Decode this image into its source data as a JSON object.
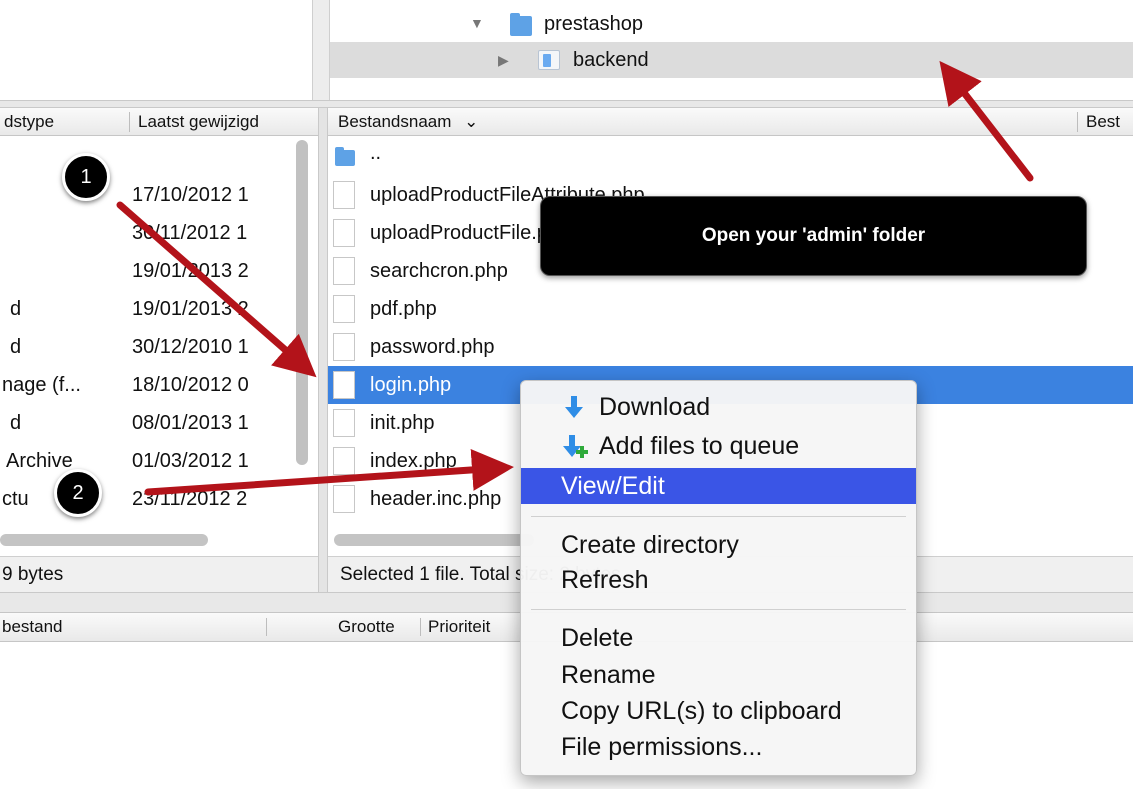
{
  "remote_tree": {
    "items": [
      {
        "label": "prestashop",
        "expanded": true
      },
      {
        "label": "backend",
        "expanded": false,
        "selected": true
      }
    ]
  },
  "left_pane": {
    "columns": [
      "dstype",
      "Laatst gewijzigd"
    ],
    "rows": [
      {
        "type": "",
        "modified": "17/10/2012 1"
      },
      {
        "type": "",
        "modified": "30/11/2012 1"
      },
      {
        "type": "",
        "modified": "19/01/2013 2"
      },
      {
        "type": "d",
        "modified": "19/01/2013 2"
      },
      {
        "type": "d",
        "modified": "30/12/2010 1"
      },
      {
        "type": "nage (f...",
        "modified": "18/10/2012 0"
      },
      {
        "type": "d",
        "modified": "08/01/2013 1"
      },
      {
        "type": "Archive",
        "modified": "01/03/2012 1"
      },
      {
        "type": "ctu",
        "modified": "23/11/2012 2"
      }
    ],
    "status": "9 bytes"
  },
  "right_pane": {
    "columns": [
      "Bestandsnaam",
      "Best"
    ],
    "parent_dir": "..",
    "rows": [
      {
        "name": "uploadProductFileAttribute.php"
      },
      {
        "name": "uploadProductFile.php"
      },
      {
        "name": "searchcron.php"
      },
      {
        "name": "pdf.php"
      },
      {
        "name": "password.php"
      },
      {
        "name": "login.php",
        "selected": true
      },
      {
        "name": "init.php"
      },
      {
        "name": "index.php"
      },
      {
        "name": "header.inc.php"
      }
    ],
    "status": "Selected 1 file. Total size: 2 bytes"
  },
  "queue": {
    "columns": [
      "bestand",
      "Grootte",
      "Prioriteit"
    ]
  },
  "tooltip": {
    "text": "Open your 'admin' folder"
  },
  "context_menu": {
    "download": "Download",
    "add_queue": "Add files to queue",
    "view_edit": "View/Edit",
    "create_dir": "Create directory",
    "refresh": "Refresh",
    "delete": "Delete",
    "rename": "Rename",
    "copy_url": "Copy URL(s) to clipboard",
    "permissions": "File permissions..."
  },
  "callouts": {
    "one": "1",
    "two": "2"
  },
  "colors": {
    "selection": "#3b82e0",
    "menu_highlight": "#3a55e6",
    "arrow": "#b3131a",
    "tooltip_bg": "#000000"
  }
}
